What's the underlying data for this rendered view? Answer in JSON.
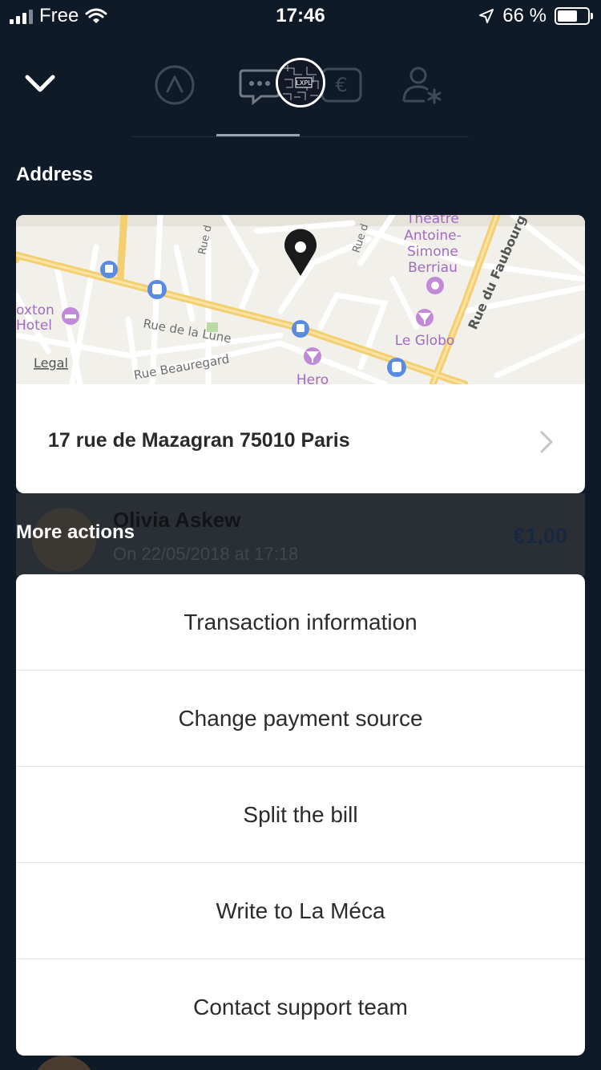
{
  "status_bar": {
    "carrier": "Free",
    "time": "17:46",
    "battery": "66 %",
    "battery_level": 0.66
  },
  "header": {
    "tabs": [
      "activity-icon",
      "chat-icon",
      "euro-icon",
      "user-settings-icon"
    ],
    "merchant_logo": "merchant-avatar"
  },
  "address_section": {
    "title": "Address",
    "map_labels": {
      "theatre": "Theatre Antoine-Simone Berriau",
      "theatre_l1": "Theatre",
      "theatre_l2": "Antoine-",
      "theatre_l3": "Simone",
      "theatre_l4": "Berriau",
      "hotel_l1": "oxton",
      "hotel_l2": "Hotel",
      "street_lune": "Rue de la Lune",
      "street_beauregard": "Rue Beauregard",
      "street_faubourg": "Rue du Faubourg",
      "street_d1": "Rue d",
      "street_d2": "Rue d",
      "bar_globo": "Le Globo",
      "bar_hero": "Hero",
      "legal": "Legal"
    },
    "address": "17 rue de Mazagran 75010 Paris"
  },
  "transaction_preview": {
    "name": "Olivia Askew",
    "date": "On 22/05/2018 at 17:18",
    "amount": "€1,00"
  },
  "more_actions": {
    "title": "More actions",
    "items": [
      "Transaction information",
      "Change payment source",
      "Split the bill",
      "Write to La Méca",
      "Contact support team"
    ]
  },
  "colors": {
    "background": "#0f1a29",
    "card": "#ffffff",
    "map_road": "#fbd46a",
    "poi_purple": "#c08ad8",
    "transit_blue": "#5b8be0"
  }
}
